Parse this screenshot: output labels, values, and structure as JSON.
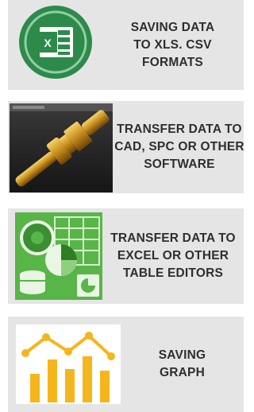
{
  "features": [
    {
      "label": "SAVING DATA\nTO XLS. CSV\nFORMATS",
      "icon": "excel-file-icon"
    },
    {
      "label": "TRANSFER DATA TO\nCAD, SPC OR OTHER\nSOFTWARE",
      "icon": "cad-part-render-image"
    },
    {
      "label": "TRANSFER DATA TO\nEXCEL OR OTHER\nTABLE EDITORS",
      "icon": "office-apps-icon"
    },
    {
      "label": "SAVING\nGRAPH",
      "icon": "bar-line-graph-icon"
    }
  ],
  "colors": {
    "card_bg": "#e5e5e5",
    "text": "#2e2e2e",
    "excel_green": "#2e8a4a",
    "office_green": "#58b548",
    "graph_bar": "#f5b51c"
  }
}
